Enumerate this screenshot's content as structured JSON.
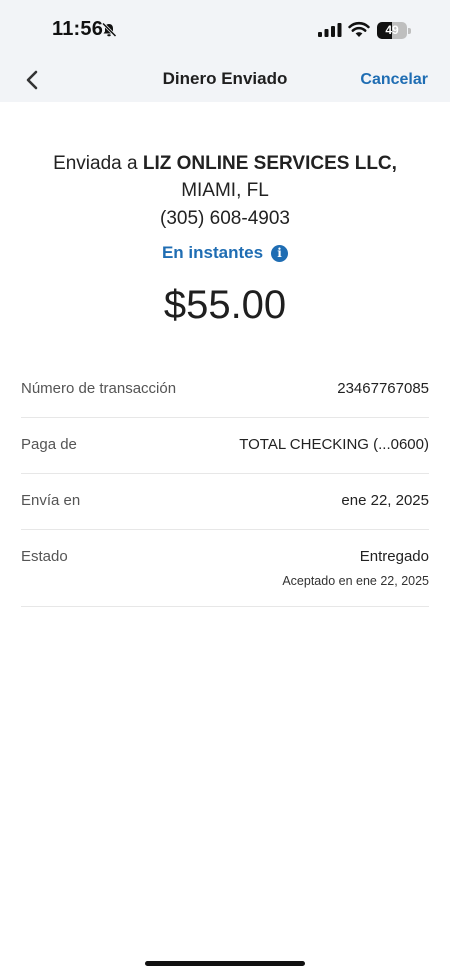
{
  "status_bar": {
    "time": "11:56",
    "battery": "49",
    "battery_level": 0.49,
    "icons": [
      "bell-slash-icon",
      "cellular-signal-icon",
      "wifi-icon",
      "battery-icon"
    ]
  },
  "nav": {
    "title": "Dinero Enviado",
    "cancel_label": "Cancelar",
    "back_icon": "chevron-left-icon"
  },
  "recipient": {
    "prefix": "Enviada a ",
    "name": "LIZ ONLINE SERVICES LLC,",
    "location": "MIAMI, FL",
    "phone": "(305) 608-4903"
  },
  "speed": {
    "label": "En instantes",
    "info_icon": "info-icon",
    "info_glyph": "i"
  },
  "amount": "$55.00",
  "details": [
    {
      "label": "Número de transacción",
      "value": "23467767085"
    },
    {
      "label": "Paga de",
      "value": "TOTAL CHECKING (...0600)"
    },
    {
      "label": "Envía en",
      "value": "ene 22, 2025"
    },
    {
      "label": "Estado",
      "value": "Entregado",
      "sub": "Aceptado en ene 22, 2025"
    }
  ],
  "colors": {
    "accent": "#1f6db3",
    "header_bg": "#f2f4f7",
    "divider": "#e7e7e7"
  }
}
